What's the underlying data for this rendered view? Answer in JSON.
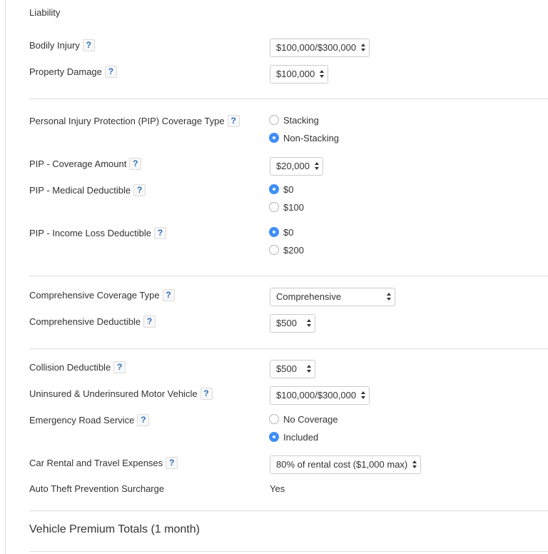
{
  "colors": {
    "accent": "#3e8ef7",
    "help_text": "#2a6ebb",
    "divider": "#dddddd"
  },
  "liability": {
    "heading": "Liability",
    "bodily_injury": {
      "label": "Bodily Injury",
      "help": "?",
      "value": "$100,000/$300,000"
    },
    "property_damage": {
      "label": "Property Damage",
      "help": "?",
      "value": "$100,000"
    }
  },
  "pip": {
    "coverage_type": {
      "label": "Personal Injury Protection (PIP) Coverage Type",
      "help": "?",
      "options": [
        {
          "label": "Stacking",
          "checked": false
        },
        {
          "label": "Non-Stacking",
          "checked": true
        }
      ]
    },
    "coverage_amount": {
      "label": "PIP - Coverage Amount",
      "help": "?",
      "value": "$20,000"
    },
    "medical_deductible": {
      "label": "PIP - Medical Deductible",
      "help": "?",
      "options": [
        {
          "label": "$0",
          "checked": true
        },
        {
          "label": "$100",
          "checked": false
        }
      ]
    },
    "income_loss_deductible": {
      "label": "PIP - Income Loss Deductible",
      "help": "?",
      "options": [
        {
          "label": "$0",
          "checked": true
        },
        {
          "label": "$200",
          "checked": false
        }
      ]
    }
  },
  "comprehensive": {
    "coverage_type": {
      "label": "Comprehensive Coverage Type",
      "help": "?",
      "value": "Comprehensive"
    },
    "deductible": {
      "label": "Comprehensive Deductible",
      "help": "?",
      "value": "$500"
    }
  },
  "other": {
    "collision_deductible": {
      "label": "Collision Deductible",
      "help": "?",
      "value": "$500"
    },
    "uninsured_motorist": {
      "label": "Uninsured & Underinsured Motor Vehicle",
      "help": "?",
      "value": "$100,000/$300,000"
    },
    "emergency_road_service": {
      "label": "Emergency Road Service",
      "help": "?",
      "options": [
        {
          "label": "No Coverage",
          "checked": false
        },
        {
          "label": "Included",
          "checked": true
        }
      ]
    },
    "car_rental": {
      "label": "Car Rental and Travel Expenses",
      "help": "?",
      "value": "80% of rental cost ($1,000 max)"
    },
    "auto_theft": {
      "label": "Auto Theft Prevention Surcharge",
      "value": "Yes"
    }
  },
  "totals": {
    "heading": "Vehicle Premium Totals (1 month)"
  }
}
